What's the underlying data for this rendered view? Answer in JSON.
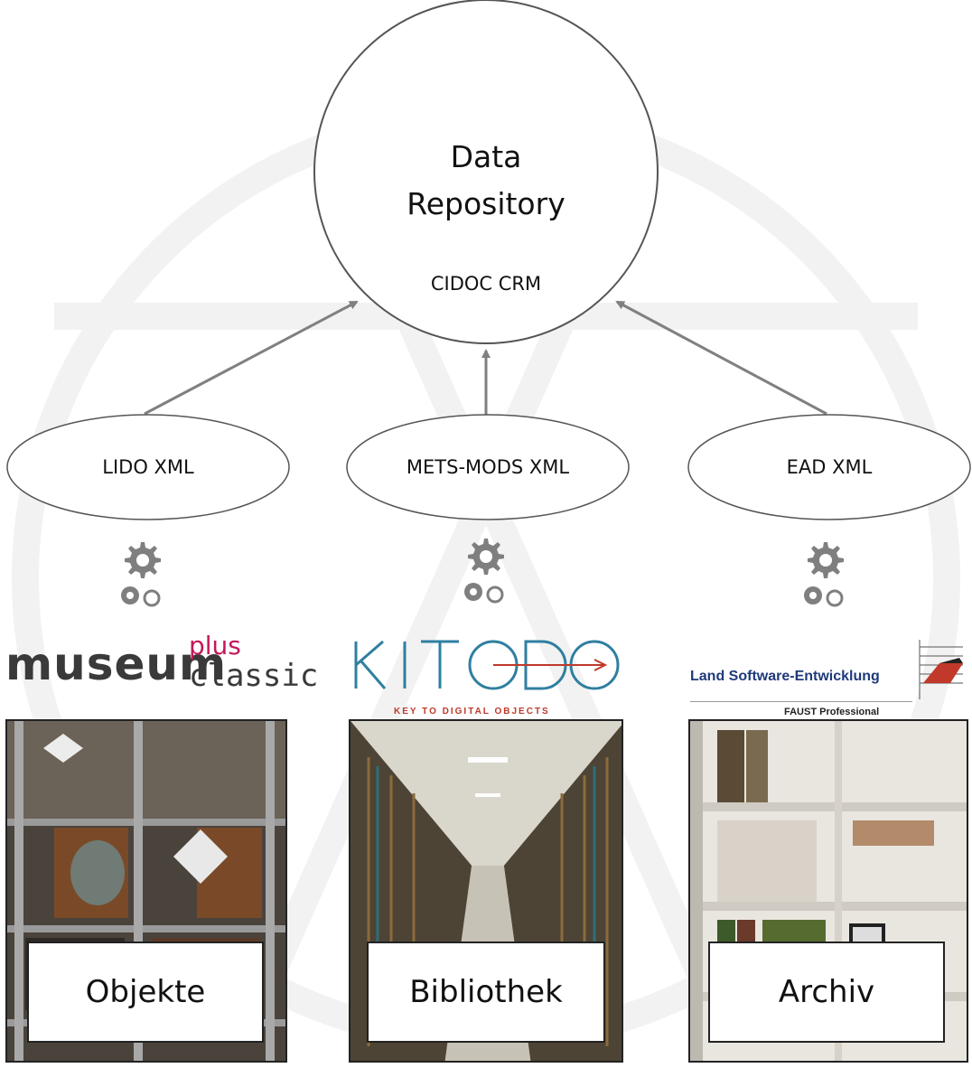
{
  "repository": {
    "title_line1": "Data",
    "title_line2": "Repository",
    "standard": "CIDOC CRM"
  },
  "formats": [
    {
      "label": "LIDO XML"
    },
    {
      "label": "METS-MODS XML"
    },
    {
      "label": "EAD XML"
    }
  ],
  "systems": {
    "museum": {
      "word": "museum",
      "plus": "plus",
      "classic": "classic"
    },
    "kitodo": {
      "name": "KITODO",
      "tagline": "KEY TO DIGITAL OBJECTS"
    },
    "faust": {
      "company": "Land Software-Entwicklung",
      "product": "FAUST Professional"
    }
  },
  "collections": [
    {
      "label": "Objekte"
    },
    {
      "label": "Bibliothek"
    },
    {
      "label": "Archiv"
    }
  ],
  "colors": {
    "arrow": "#808080",
    "gear": "#7f7f7f",
    "kitodo_blue": "#2f7fa0",
    "kitodo_red": "#c0392b",
    "faust_navy": "#1f3a7a"
  }
}
